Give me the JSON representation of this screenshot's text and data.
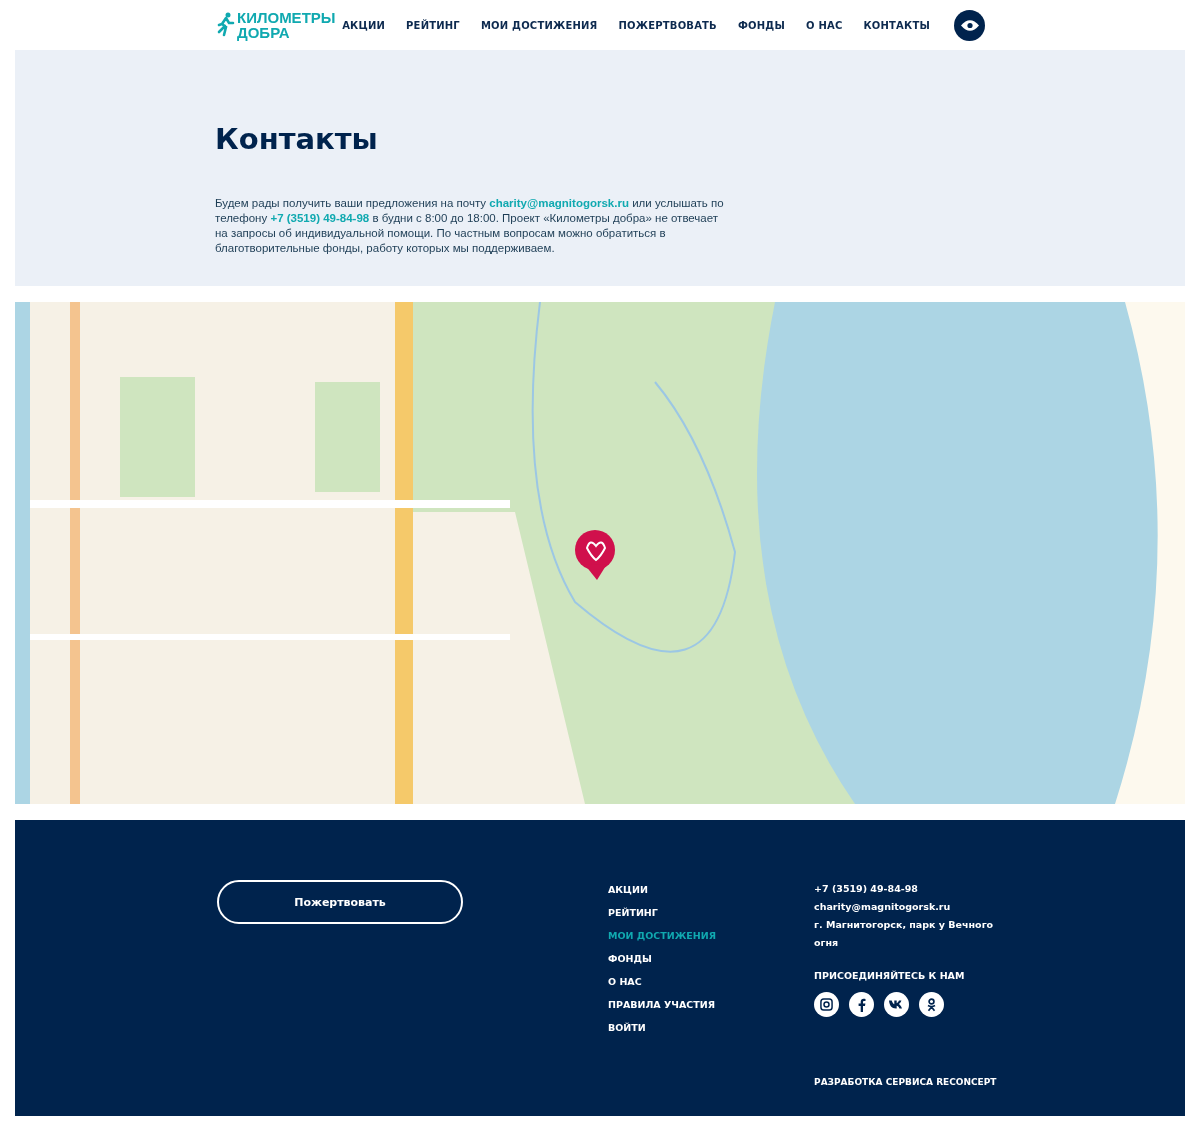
{
  "header": {
    "logo": [
      "КИЛОМЕТРЫ",
      "ДОБРА"
    ],
    "nav": [
      "АКЦИИ",
      "РЕЙТИНГ",
      "МОИ ДОСТИЖЕНИЯ",
      "ПОЖЕРТВОВАТЬ",
      "ФОНДЫ",
      "О НАС",
      "КОНТАКТЫ"
    ]
  },
  "hero": {
    "title": "Контакты",
    "text": "Будем рады получить ваши предложения на почту **charity@magnitogorsk.ru** или услышать по телефону **+7 (3519) 49-84-98** в будни с 8:00 до 18:00. Проект «Километры добра» не отвечает на запросы об индивидуальной помощи. По частным вопросам можно обратиться в благотворительные фонды, работу которых мы поддерживаем."
  },
  "footer": {
    "donate_button": "Пожертвовать",
    "menu": [
      {
        "label": "АКЦИИ",
        "selected": false
      },
      {
        "label": "РЕЙТИНГ",
        "selected": false
      },
      {
        "label": "МОИ ДОСТИЖЕНИЯ",
        "selected": true
      },
      {
        "label": "ФОНДЫ",
        "selected": false
      },
      {
        "label": "О НАС",
        "selected": false
      },
      {
        "label": "ПРАВИЛА УЧАСТИЯ",
        "selected": false
      },
      {
        "label": "ВОЙТИ",
        "selected": false
      }
    ],
    "contacts": [
      "+7 (3519) 49-84-98",
      "charity@magnitogorsk.ru",
      "г. Магнитогорск, парк у Вечного огня"
    ],
    "social_title": "ПРИСОЕДИНЯЙТЕСЬ К НАМ",
    "socials": [
      {
        "kind": "instagram"
      },
      {
        "kind": "facebook"
      },
      {
        "kind": "vk"
      },
      {
        "kind": "ok"
      }
    ],
    "credit": "РАЗРАБОТКА СЕРВИСА RECONCEPT"
  }
}
